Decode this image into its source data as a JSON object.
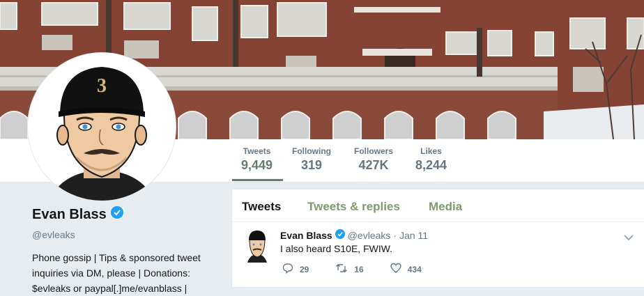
{
  "profile": {
    "name": "Evan Blass",
    "handle": "@evleaks",
    "bio_lines": [
      "Phone gossip | Tips & sponsored tweet",
      "inquiries via DM, please | Donations:",
      "$evleaks or paypal[.]me/evanblass |"
    ],
    "cap_number": "3"
  },
  "stats": [
    {
      "label": "Tweets",
      "value": "9,449",
      "active": true
    },
    {
      "label": "Following",
      "value": "319",
      "active": false
    },
    {
      "label": "Followers",
      "value": "427K",
      "active": false
    },
    {
      "label": "Likes",
      "value": "8,244",
      "active": false
    }
  ],
  "tabs": [
    {
      "label": "Tweets",
      "active": true
    },
    {
      "label": "Tweets & replies",
      "active": false
    },
    {
      "label": "Media",
      "active": false
    }
  ],
  "tweet": {
    "author": "Evan Blass",
    "handle": "@evleaks",
    "separator": "·",
    "date": "Jan 11",
    "text": "I also heard S10E, FWIW.",
    "replies": "29",
    "retweets": "16",
    "likes": "434"
  },
  "colors": {
    "accent": "#657e6b",
    "tab_inactive": "#7e9a6e",
    "verified": "#1da1f2",
    "page_bg": "#e6ecf0"
  }
}
